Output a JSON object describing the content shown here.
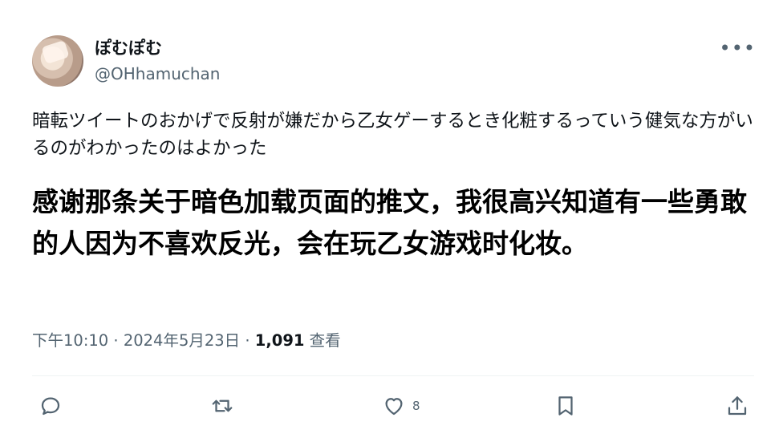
{
  "user": {
    "display_name": "ぽむぽむ",
    "handle": "@OHhamuchan"
  },
  "tweet": {
    "text_jp": "暗転ツイートのおかげで反射が嫌だから乙女ゲーするとき化粧するっていう健気な方がいるのがわかったのはよかった",
    "text_zh": "感谢那条关于暗色加载页面的推文，我很高兴知道有一些勇敢的人因为不喜欢反光，会在玩乙女游戏时化妆。"
  },
  "meta": {
    "time": "下午10:10",
    "separator": "·",
    "date": "2024年5月23日",
    "views_count": "1,091",
    "views_label": "查看"
  },
  "actions": {
    "reply_icon": "reply-icon",
    "retweet_icon": "retweet-icon",
    "like_icon": "heart-icon",
    "like_count": "8",
    "bookmark_icon": "bookmark-icon",
    "share_icon": "share-icon"
  },
  "colors": {
    "text": "#0f1419",
    "secondary": "#536471",
    "divider": "#eff3f4"
  }
}
